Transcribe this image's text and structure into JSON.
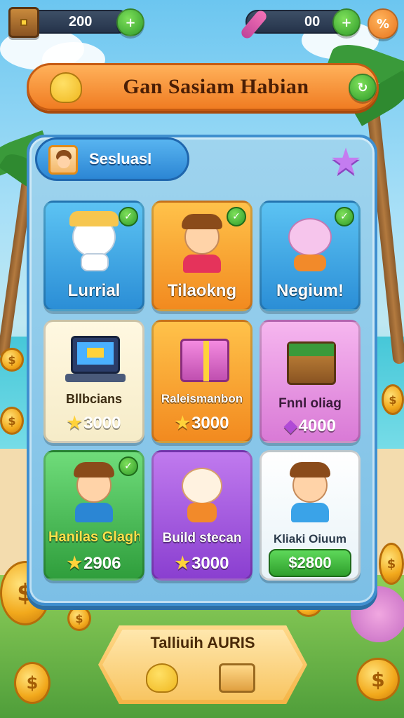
{
  "hud": {
    "left_value": "200",
    "left_icon": "chest-icon",
    "left_button_icon": "plus-icon",
    "right_value": "00",
    "right_icon": "pencil-icon",
    "right_button_icon": "plus-icon",
    "settings_icon": "percent-icon"
  },
  "banner": {
    "title": "Gan Sasiam Habian",
    "icon": "bell-character-icon",
    "action_icon": "refresh-icon"
  },
  "panel": {
    "tab_title": "Sesluasl",
    "tab_icon": "avatar-icon",
    "favorite_icon": "star-icon"
  },
  "cards": [
    {
      "label": "Lurrial",
      "price": "",
      "checked": true,
      "theme": "blue"
    },
    {
      "label": "Tilaokng",
      "price": "",
      "checked": true,
      "theme": "orange"
    },
    {
      "label": "Negium!",
      "price": "",
      "checked": true,
      "theme": "blue"
    },
    {
      "label": "Bllbcians",
      "price": "3000",
      "price_icon": "star-icon",
      "theme": "cream"
    },
    {
      "label": "Raleismanbon",
      "price": "3000",
      "price_icon": "star-icon",
      "theme": "orange"
    },
    {
      "label": "Fnnl oliag",
      "price": "4000",
      "price_icon": "gem-icon",
      "theme": "pink"
    },
    {
      "label": "Hanilas Glagh",
      "price": "2906",
      "price_icon": "star-icon",
      "checked": true,
      "theme": "green"
    },
    {
      "label": "Build stecan",
      "price": "3000",
      "price_icon": "star-icon",
      "theme": "purple"
    },
    {
      "label": "Kliaki Oiuum",
      "price": "$2800",
      "theme": "white"
    }
  ],
  "bottom": {
    "title": "Talliuih AURIS"
  },
  "colors": {
    "accent_orange": "#f07c22",
    "panel_blue": "#3f8fcf",
    "green": "#2f9a2a"
  }
}
